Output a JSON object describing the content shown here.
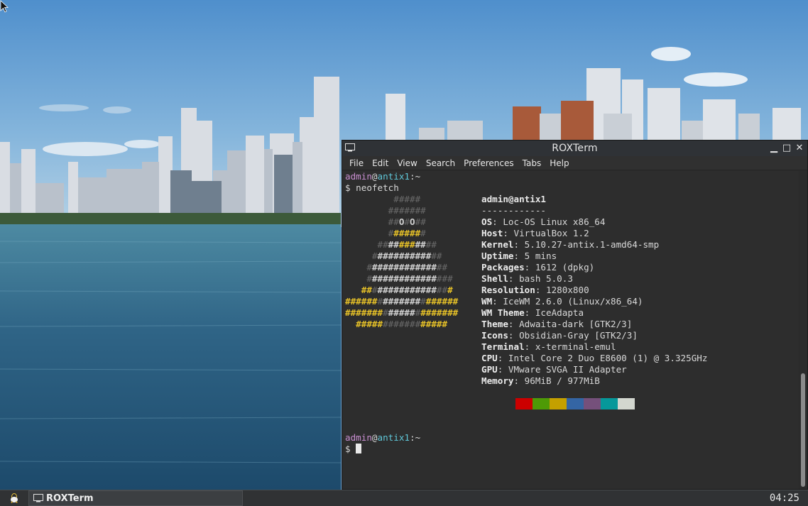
{
  "window": {
    "title": "ROXTerm",
    "minimize_glyph": "▁",
    "maximize_glyph": "□",
    "close_glyph": "✕"
  },
  "menu": [
    "File",
    "Edit",
    "View",
    "Search",
    "Preferences",
    "Tabs",
    "Help"
  ],
  "terminal": {
    "prompt_user": "admin",
    "prompt_at": "@",
    "prompt_host": "antix1",
    "prompt_suffix": ":~",
    "command_line": "$ neofetch",
    "final_prompt": "$ ",
    "header": "admin@antix1",
    "separator": "------------",
    "info": [
      {
        "key": "OS",
        "value": "Loc-OS Linux x86_64"
      },
      {
        "key": "Host",
        "value": "VirtualBox 1.2"
      },
      {
        "key": "Kernel",
        "value": "5.10.27-antix.1-amd64-smp"
      },
      {
        "key": "Uptime",
        "value": "5 mins"
      },
      {
        "key": "Packages",
        "value": "1612 (dpkg)"
      },
      {
        "key": "Shell",
        "value": "bash 5.0.3"
      },
      {
        "key": "Resolution",
        "value": "1280x800"
      },
      {
        "key": "WM",
        "value": "IceWM 2.6.0 (Linux/x86_64)"
      },
      {
        "key": "WM Theme",
        "value": "IceAdapta"
      },
      {
        "key": "Theme",
        "value": "Adwaita-dark [GTK2/3]"
      },
      {
        "key": "Icons",
        "value": "Obsidian-Gray [GTK2/3]"
      },
      {
        "key": "Terminal",
        "value": "x-terminal-emul"
      },
      {
        "key": "CPU",
        "value": "Intel Core 2 Duo E8600 (1) @ 3.325GHz"
      },
      {
        "key": "GPU",
        "value": "VMware SVGA II Adapter"
      },
      {
        "key": "Memory",
        "value": "96MiB / 977MiB"
      }
    ],
    "ascii_logo": [
      [
        [
          "g",
          "         #####"
        ]
      ],
      [
        [
          "g",
          "        #######"
        ]
      ],
      [
        [
          "g",
          "        ##"
        ],
        [
          "w",
          "O"
        ],
        [
          "g",
          "#"
        ],
        [
          "w",
          "O"
        ],
        [
          "g",
          "##"
        ]
      ],
      [
        [
          "g",
          "        #"
        ],
        [
          "y",
          "#####"
        ],
        [
          "g",
          "#"
        ]
      ],
      [
        [
          "g",
          "      ##"
        ],
        [
          "w",
          "##"
        ],
        [
          "y",
          "###"
        ],
        [
          "w",
          "##"
        ],
        [
          "g",
          "##"
        ]
      ],
      [
        [
          "g",
          "     #"
        ],
        [
          "w",
          "##########"
        ],
        [
          "g",
          "##"
        ]
      ],
      [
        [
          "g",
          "    #"
        ],
        [
          "w",
          "############"
        ],
        [
          "g",
          "##"
        ]
      ],
      [
        [
          "g",
          "    #"
        ],
        [
          "w",
          "############"
        ],
        [
          "g",
          "###"
        ]
      ],
      [
        [
          "y",
          "   ##"
        ],
        [
          "g",
          "#"
        ],
        [
          "w",
          "###########"
        ],
        [
          "g",
          "##"
        ],
        [
          "y",
          "#"
        ]
      ],
      [
        [
          "y",
          "######"
        ],
        [
          "g",
          "#"
        ],
        [
          "w",
          "#######"
        ],
        [
          "g",
          "#"
        ],
        [
          "y",
          "######"
        ]
      ],
      [
        [
          "y",
          "#######"
        ],
        [
          "g",
          "#"
        ],
        [
          "w",
          "#####"
        ],
        [
          "g",
          "#"
        ],
        [
          "y",
          "#######"
        ]
      ],
      [
        [
          "y",
          "  #####"
        ],
        [
          "g",
          "#######"
        ],
        [
          "y",
          "#####"
        ]
      ]
    ],
    "palette": [
      "#2d2d2d",
      "#cc0000",
      "#4e9a06",
      "#c4a000",
      "#3465a4",
      "#75507b",
      "#06989a",
      "#d3d7cf"
    ]
  },
  "taskbar": {
    "task_label": "ROXTerm",
    "clock": "04:25"
  },
  "icons": {
    "start": "antix-logo-icon",
    "terminal": "terminal-icon"
  }
}
